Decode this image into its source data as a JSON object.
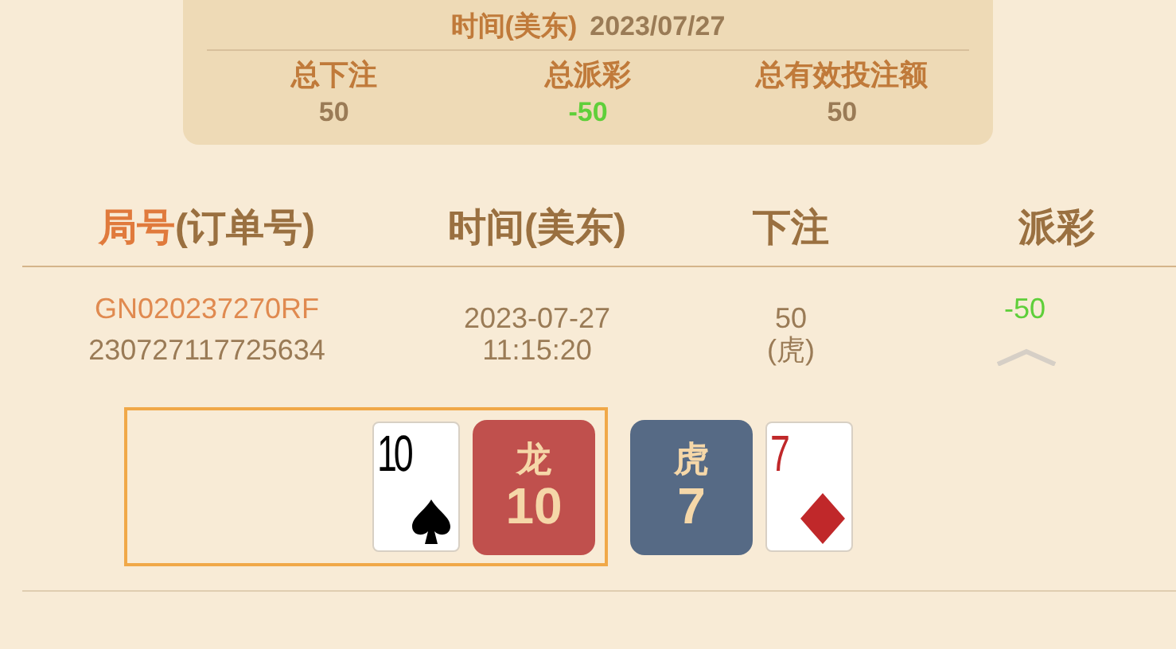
{
  "summary": {
    "date_label": "时间(美东)",
    "date": "2023/07/27",
    "totals": [
      {
        "label": "总下注",
        "value": "50",
        "kind": "plain"
      },
      {
        "label": "总派彩",
        "value": "-50",
        "kind": "negative"
      },
      {
        "label": "总有效投注额",
        "value": "50",
        "kind": "plain"
      }
    ]
  },
  "table": {
    "columns": [
      {
        "accent": "局号",
        "label": "(订单号)"
      },
      {
        "label": "时间(美东)"
      },
      {
        "label": "下注"
      },
      {
        "label": "派彩"
      }
    ],
    "rows": [
      {
        "round_id": "GN020237270RF",
        "order_id": "230727117725634",
        "date": "2023-07-27",
        "time": "11:15:20",
        "bet": "50",
        "bet_side": "(虎)",
        "payout": {
          "value": "-50",
          "kind": "negative"
        },
        "expanded": true,
        "hands": [
          {
            "cards": [
              {
                "rank": "10",
                "kind": "spade"
              }
            ],
            "tile": {
              "label": "龙",
              "value": "10",
              "color": "#c0504d"
            },
            "winner": true
          },
          {
            "cards": [
              {
                "rank": "7",
                "kind": "diamond"
              }
            ],
            "tile": {
              "label": "虎",
              "value": "7",
              "color": "#566a85"
            },
            "winner": false
          }
        ]
      }
    ]
  }
}
